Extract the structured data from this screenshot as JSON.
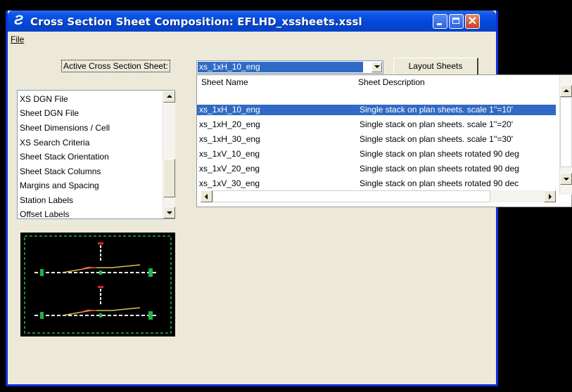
{
  "window": {
    "title": "Cross Section Sheet Composition: EFLHD_xssheets.xssl",
    "icon": "app-logo-icon",
    "controls": [
      "minimize",
      "maximize",
      "close"
    ]
  },
  "menu": {
    "file_label": "File"
  },
  "form": {
    "active_label": "Active Cross Section Sheet:",
    "active_value": "xs_1xH_10_eng",
    "layout_button": "Layout Sheets"
  },
  "dropdown": {
    "col_name": "Sheet Name",
    "col_desc": "Sheet Description",
    "rows": [
      {
        "name": "xs_1xH_10_eng",
        "desc": "Single stack on plan sheets. scale 1''=10'",
        "selected": true
      },
      {
        "name": "xs_1xH_20_eng",
        "desc": "Single stack on plan sheets. scale 1''=20'"
      },
      {
        "name": "xs_1xH_30_eng",
        "desc": "Single stack on plan sheets. scale 1''=30'"
      },
      {
        "name": "xs_1xV_10_eng",
        "desc": "Single stack on plan sheets rotated 90 deg"
      },
      {
        "name": "xs_1xV_20_eng",
        "desc": "Single stack on plan sheets rotated 90 deg"
      },
      {
        "name": "xs_1xV_30_eng",
        "desc": "Single stack on plan sheets rotated 90 dec"
      }
    ]
  },
  "categories": [
    "XS DGN File",
    "Sheet DGN File",
    "Sheet Dimensions / Cell",
    "XS Search Criteria",
    "Sheet Stack Orientation",
    "Sheet Stack Columns",
    "Margins and Spacing",
    "Station Labels",
    "Offset Labels"
  ],
  "colors": {
    "title_bar": "#0447d6",
    "selection": "#316ac5",
    "dialog_bg": "#ece9d8",
    "preview_border": "#1fb34a"
  }
}
